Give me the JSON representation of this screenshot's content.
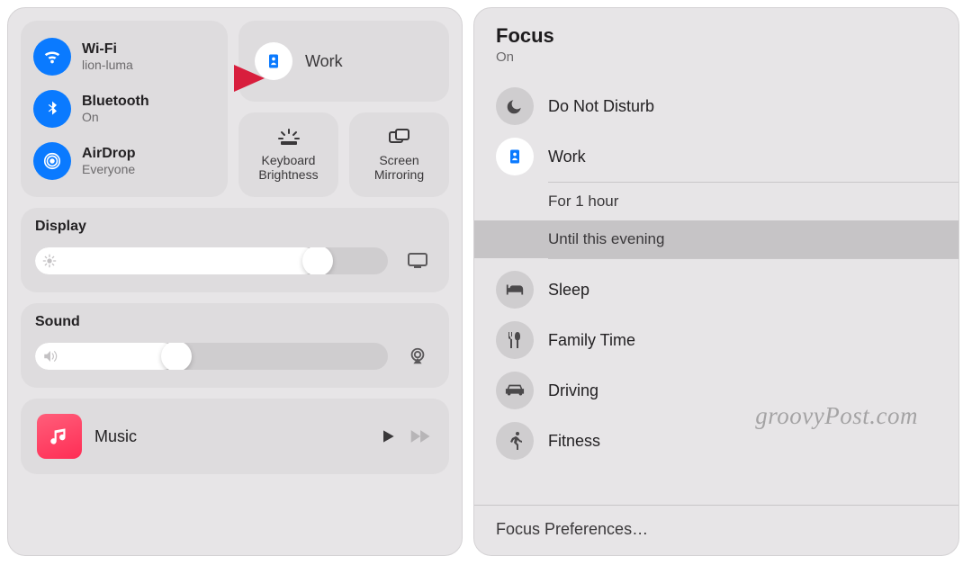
{
  "control_center": {
    "wifi": {
      "title": "Wi-Fi",
      "sub": "lion-luma"
    },
    "bluetooth": {
      "title": "Bluetooth",
      "sub": "On"
    },
    "airdrop": {
      "title": "AirDrop",
      "sub": "Everyone"
    },
    "focus": {
      "label": "Work"
    },
    "keyboard_brightness": {
      "label": "Keyboard Brightness"
    },
    "screen_mirroring": {
      "label": "Screen Mirroring"
    },
    "display": {
      "title": "Display",
      "value_pct": 80
    },
    "sound": {
      "title": "Sound",
      "value_pct": 40
    },
    "music": {
      "title": "Music"
    }
  },
  "focus_panel": {
    "title": "Focus",
    "status": "On",
    "modes": [
      {
        "key": "dnd",
        "label": "Do Not Disturb",
        "icon": "moon",
        "active": false
      },
      {
        "key": "work",
        "label": "Work",
        "icon": "badge",
        "active": true,
        "durations": [
          {
            "label": "For 1 hour",
            "selected": false
          },
          {
            "label": "Until this evening",
            "selected": true
          }
        ]
      },
      {
        "key": "sleep",
        "label": "Sleep",
        "icon": "bed",
        "active": false
      },
      {
        "key": "family",
        "label": "Family Time",
        "icon": "utensils",
        "active": false
      },
      {
        "key": "driving",
        "label": "Driving",
        "icon": "car",
        "active": false
      },
      {
        "key": "fitness",
        "label": "Fitness",
        "icon": "running",
        "active": false
      }
    ],
    "footer": "Focus Preferences…"
  },
  "watermark": "groovyPost.com"
}
